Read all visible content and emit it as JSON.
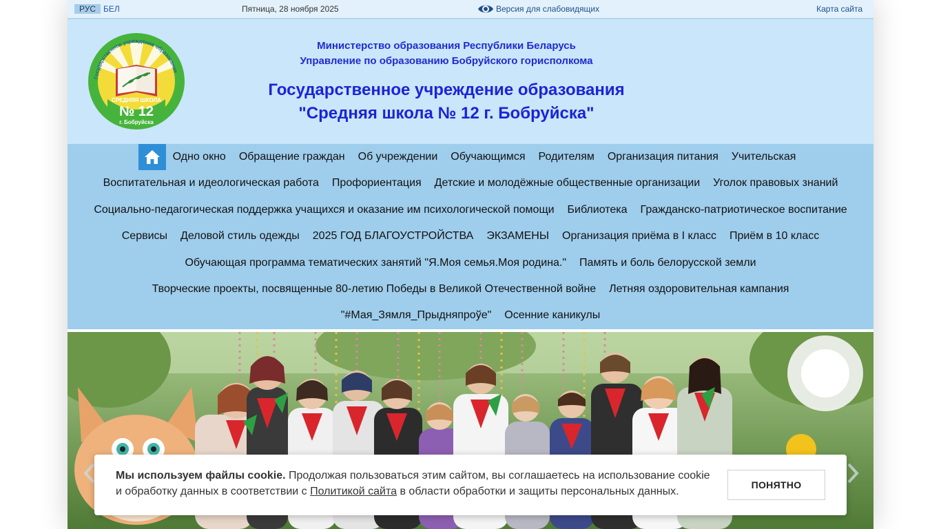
{
  "topbar": {
    "lang_active": "РУС",
    "lang_other": "БЕЛ",
    "date": "Пятница, 28 ноября 2025",
    "vision_label": "Версия для слабовидящих",
    "sitemap_label": "Карта сайта"
  },
  "header": {
    "ministry_line1": "Министерство образования Республики Беларусь",
    "ministry_line2": "Управление по образованию Бобруйского горисполкома",
    "school_line1": "Государственное учреждение образования",
    "school_line2": "\"Средняя школа № 12 г. Бобруйска\"",
    "logo": {
      "arc_text": "Государственное учреждение образования",
      "line1": "СРЕДНЯЯ ШКОЛА",
      "line2": "№ 12",
      "line3": "г. Бобруйска"
    }
  },
  "nav": {
    "rows": [
      [
        "Одно окно",
        "Обращение граждан",
        "Об учреждении",
        "Обучающимся",
        "Родителям",
        "Организация питания",
        "Учительская"
      ],
      [
        "Воспитательная и идеологическая работа",
        "Профориентация",
        "Детские и молодёжные общественные организации",
        "Уголок правовых знаний"
      ],
      [
        "Социально-педагогическая поддержка учащихся и оказание им психологической помощи",
        "Библиотека",
        "Гражданско-патриотическое воспитание"
      ],
      [
        "Сервисы",
        "Деловой стиль одежды",
        "2025 ГОД БЛАГОУСТРОЙСТВА",
        "ЭКЗАМЕНЫ",
        "Организация приёма в I класс",
        "Приём в 10 класс"
      ],
      [
        "Обучающая программа тематических занятий \"Я.Моя семья.Моя родина.\"",
        "Память и боль белорусской земли"
      ],
      [
        "Творческие проекты, посвященные 80-летию Победы в Великой Отечественной войне",
        "Летняя оздоровительная кампания"
      ],
      [
        "\"#Мая_Зямля_Прыдняпроўе\"",
        "Осенние каникулы"
      ]
    ]
  },
  "cookie": {
    "bold": "Мы используем файлы cookie.",
    "text1": " Продолжая пользоваться этим сайтом, вы соглашаетесь на использование cookie и обработку данных в соответствии с ",
    "link": "Политикой сайта",
    "text2": " в области обработки и защиты персональных данных.",
    "button": "ПОНЯТНО"
  },
  "colors": {
    "header_bg": "#c9e6fa",
    "nav_bg": "#9fcdec",
    "home_btn": "#2f8fd6",
    "title_blue": "#1a24d6"
  },
  "icons": [
    "eye-icon",
    "home-icon",
    "slider-prev-icon",
    "slider-next-icon"
  ]
}
